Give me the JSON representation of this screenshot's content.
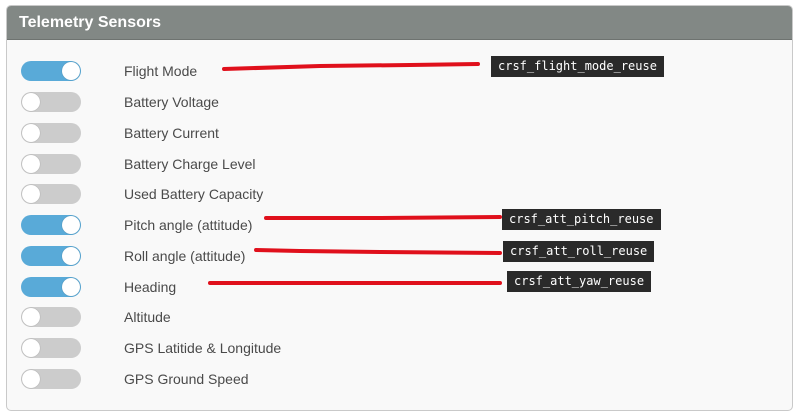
{
  "panel": {
    "title": "Telemetry Sensors"
  },
  "sensors": [
    {
      "label": "Flight Mode",
      "enabled": true,
      "code": "crsf_flight_mode_reuse"
    },
    {
      "label": "Battery Voltage",
      "enabled": false
    },
    {
      "label": "Battery Current",
      "enabled": false
    },
    {
      "label": "Battery Charge Level",
      "enabled": false
    },
    {
      "label": "Used Battery Capacity",
      "enabled": false
    },
    {
      "label": "Pitch angle (attitude)",
      "enabled": true,
      "code": "crsf_att_pitch_reuse"
    },
    {
      "label": "Roll angle (attitude)",
      "enabled": true,
      "code": "crsf_att_roll_reuse"
    },
    {
      "label": "Heading",
      "enabled": true,
      "code": "crsf_att_yaw_reuse"
    },
    {
      "label": "Altitude",
      "enabled": false
    },
    {
      "label": "GPS Latitide & Longitude",
      "enabled": false
    },
    {
      "label": "GPS Ground Speed",
      "enabled": false
    }
  ],
  "colors": {
    "toggle_on": "#59aad8",
    "toggle_off": "#cccccc",
    "annotation_line": "#e0101c",
    "code_tag_bg": "#2a2a2a"
  }
}
